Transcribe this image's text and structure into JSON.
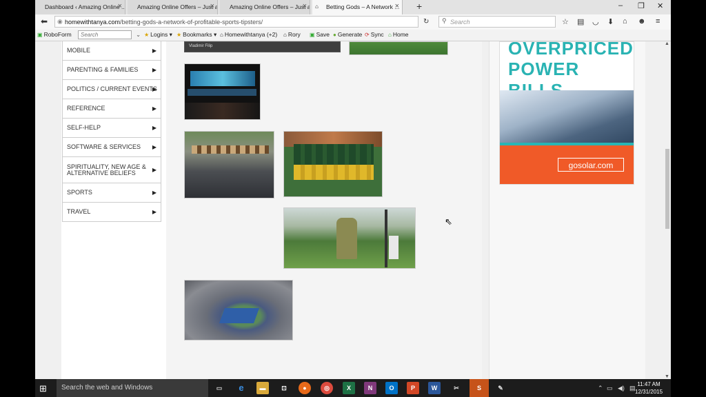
{
  "tabs": [
    {
      "label": "Dashboard ‹ Amazing Online ...",
      "active": false
    },
    {
      "label": "Amazing Online Offers – Just a...",
      "active": false
    },
    {
      "label": "Amazing Online Offers – Just a...",
      "active": false
    },
    {
      "label": "Betting Gods – A Network ...",
      "active": true
    }
  ],
  "window_controls": {
    "minimize": "–",
    "restore": "❐",
    "close": "✕"
  },
  "address": {
    "host": "homewithtanya.com",
    "path": "/betting-gods-a-network-of-profitable-sports-tipsters/"
  },
  "search_placeholder": "Search",
  "bookmarks": {
    "roboform": "RoboForm",
    "roboform_search": "Search",
    "logins": "Logins",
    "bookmarks": "Bookmarks",
    "homewithtanya": "Homewithtanya",
    "homewithtanya_badge": "(+2)",
    "rory": "Rory",
    "save": "Save",
    "generate": "Generate",
    "sync": "Sync",
    "home": "Home"
  },
  "sidebar_menu": [
    {
      "label": "MOBILE"
    },
    {
      "label": "PARENTING & FAMILIES"
    },
    {
      "label": "POLITICS / CURRENT EVENTS"
    },
    {
      "label": "REFERENCE"
    },
    {
      "label": "SELF-HELP"
    },
    {
      "label": "SOFTWARE & SERVICES"
    },
    {
      "label": "SPIRITUALITY, NEW AGE & ALTERNATIVE BELIEFS"
    },
    {
      "label": "SPORTS"
    },
    {
      "label": "TRAVEL"
    }
  ],
  "gallery_images": [
    {
      "subject": "betting-screen-snippet",
      "text": "Vladimir Filip"
    },
    {
      "subject": "football-field-top"
    },
    {
      "subject": "sports-bar-screens"
    },
    {
      "subject": "racecourse-crowd"
    },
    {
      "subject": "football-huddle"
    },
    {
      "subject": "golfer-on-course"
    },
    {
      "subject": "tennis-stadium"
    }
  ],
  "ad": {
    "headline_1": "OVERPRICED",
    "headline_2": "POWER BILLS.",
    "cta": "gosolar.com",
    "color_accent": "#2ab3b3",
    "color_orange": "#f05a28"
  },
  "taskbar": {
    "search_placeholder": "Search the web and Windows",
    "time": "11:47 AM",
    "date": "12/31/2015"
  }
}
